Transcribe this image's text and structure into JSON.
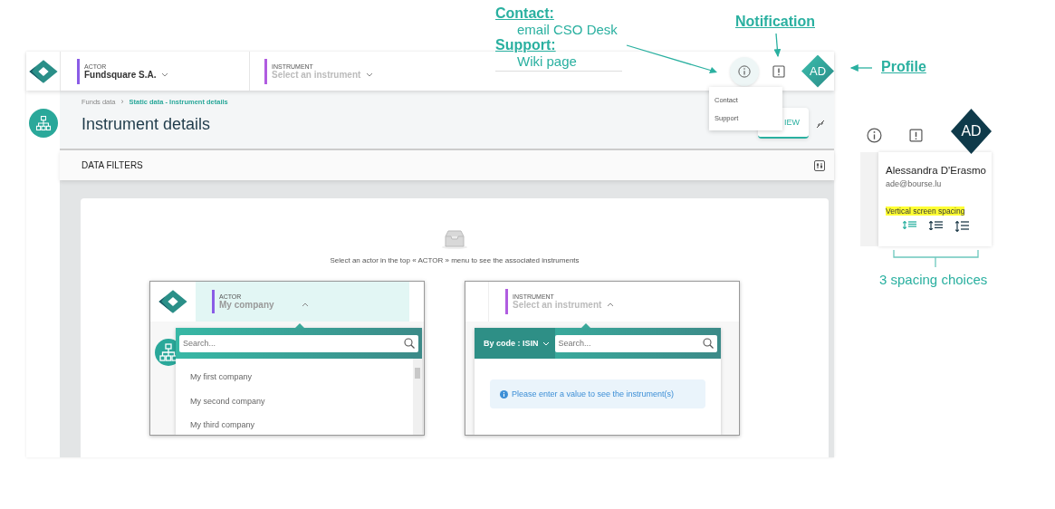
{
  "annotations": {
    "contact": {
      "heading": "Contact:",
      "text": "email CSO Desk"
    },
    "support": {
      "heading": "Support:",
      "text": "Wiki page"
    },
    "notification": "Notification",
    "profile": "Profile",
    "spacing_note": "3 spacing choices"
  },
  "app": {
    "header": {
      "actor": {
        "label": "ACTOR",
        "value": "Fundsquare S.A."
      },
      "instrument": {
        "label": "INSTRUMENT",
        "placeholder": "Select an instrument"
      },
      "avatar": "AD"
    },
    "help_menu": {
      "items": [
        "Contact",
        "Support"
      ]
    },
    "breadcrumb": [
      "Funds data",
      "Static data - Instrument details"
    ],
    "breadcrumb_separator": "›",
    "page_title": "Instrument details",
    "view_button": "IEW",
    "filters_title": "DATA FILTERS",
    "empty_message": "Select an actor in the top « ACTOR » menu to see the associated instruments"
  },
  "actor_dropdown_inset": {
    "label": "ACTOR",
    "value": "My company",
    "search_placeholder": "Search...",
    "options": [
      "My first company",
      "My second company",
      "My third company"
    ]
  },
  "instrument_dropdown_inset": {
    "label": "INSTRUMENT",
    "placeholder": "Select an instrument",
    "search_mode": "By code : ISIN",
    "search_placeholder": "Search...",
    "info": "Please enter a value to see the instrument(s)"
  },
  "profile_panel": {
    "avatar": "AD",
    "name": "Alessandra D'Erasmo",
    "email": "ade@bourse.lu",
    "spacing_label": "Vertical screen spacing",
    "spacing_options": [
      {
        "selected": true
      },
      {
        "selected": false
      },
      {
        "selected": false
      }
    ]
  }
}
